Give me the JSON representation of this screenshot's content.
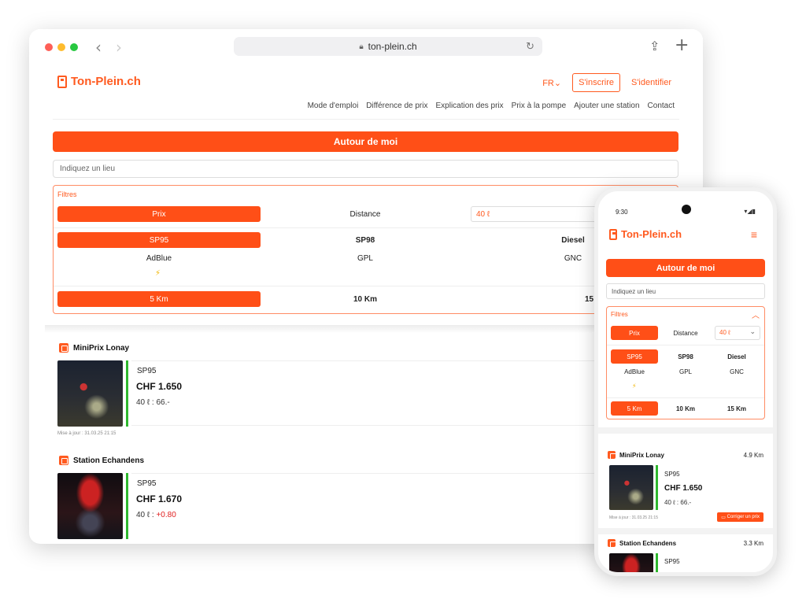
{
  "browser": {
    "url": "ton-plein.ch"
  },
  "brand": {
    "name": "Ton-Plein.ch",
    "accent": "#ff4f17"
  },
  "header": {
    "lang": "FR",
    "signup": "S'inscrire",
    "login": "S'identifier",
    "menu": [
      "Mode d'emploi",
      "Différence de prix",
      "Explication des prix",
      "Prix à la pompe",
      "Ajouter une station",
      "Contact"
    ]
  },
  "main": {
    "cta": "Autour de moi",
    "place_placeholder": "Indiquez un lieu",
    "filters": {
      "title": "Filtres",
      "sort": [
        "Prix",
        "Distance"
      ],
      "litres": "40 ℓ",
      "fuels": [
        "SP95",
        "SP98",
        "Diesel",
        "AdBlue",
        "GPL",
        "GNC"
      ],
      "radius": [
        "5 Km",
        "10 Km",
        "15 Km"
      ]
    }
  },
  "stations": [
    {
      "name": "MiniPrix Lonay",
      "fuel": "SP95",
      "price": "CHF 1.650",
      "total_prefix": "40 ℓ : ",
      "total": "66.-",
      "updated": "Mise à jour : 31.03.25 21:15",
      "distance": "4.9 Km"
    },
    {
      "name": "Station Echandens",
      "fuel": "SP95",
      "price": "CHF 1.670",
      "total_prefix": "40 ℓ : ",
      "total": "+0.80",
      "distance": "3.3 Km"
    }
  ],
  "phone": {
    "time": "9:30",
    "fix_price": "Corriger un prix",
    "updated": "Mise à jour : 31.03.25 21:15"
  }
}
